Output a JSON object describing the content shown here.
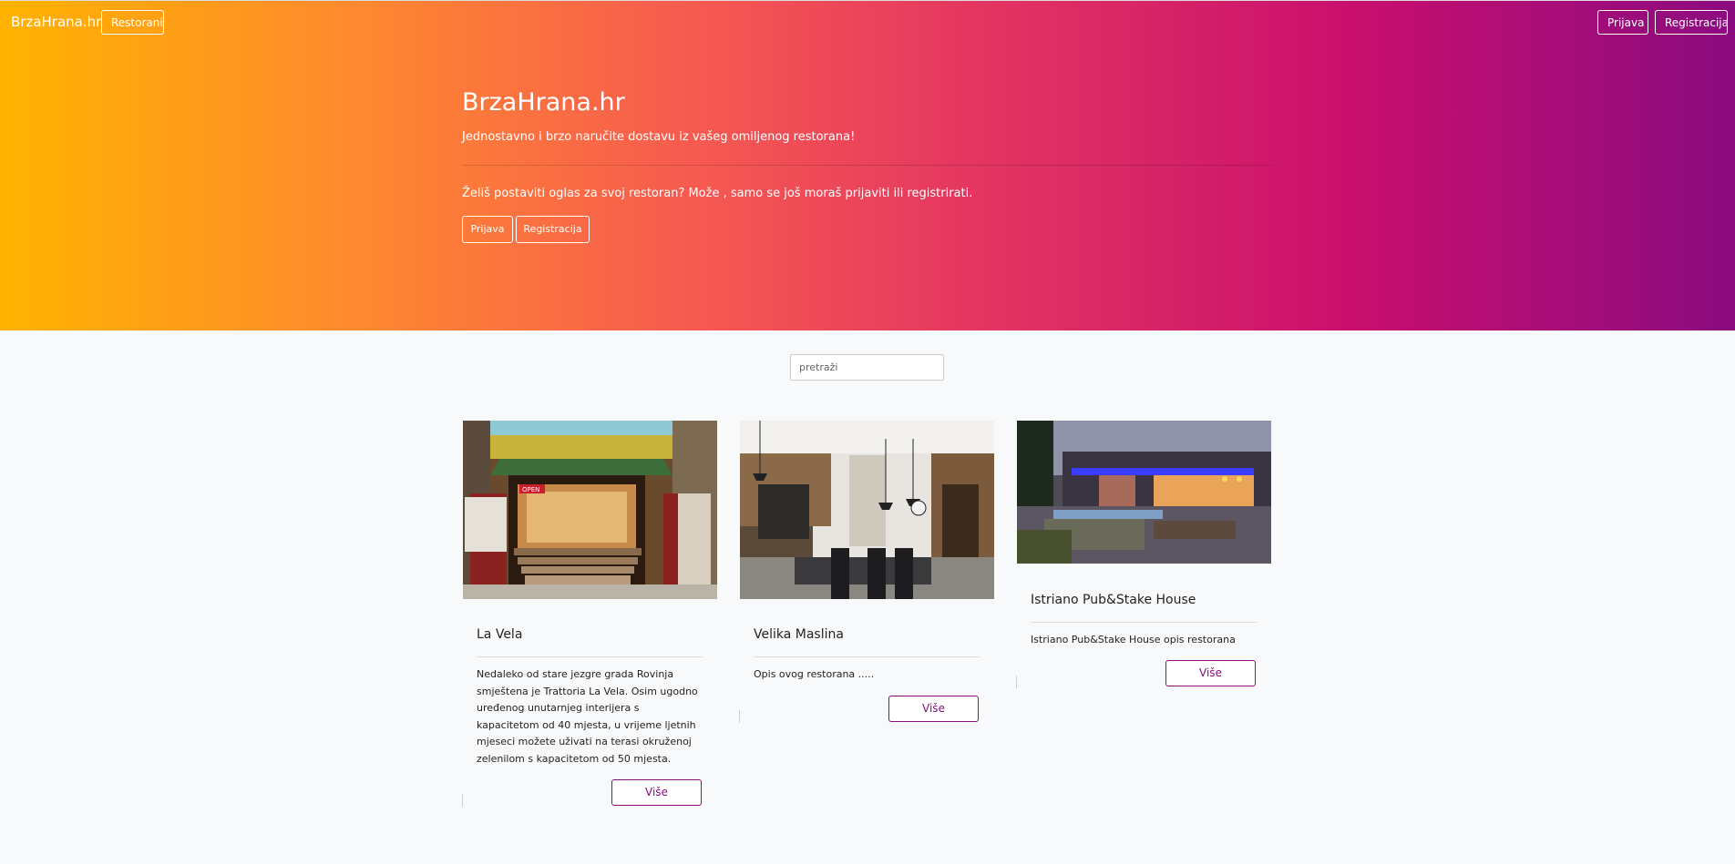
{
  "nav": {
    "brand": "BrzaHrana.hr",
    "restorani": "Restorani",
    "prijava": "Prijava",
    "registracija": "Registracija"
  },
  "hero": {
    "title": "BrzaHrana.hr",
    "subtitle": "Jednostavno i brzo naručite dostavu iz vašeg omiljenog restorana!",
    "cta_text": "Želiš postaviti oglas za svoj restoran? Može , samo se još moraš prijaviti ili registrirati.",
    "prijava": "Prijava",
    "registracija": "Registracija"
  },
  "search": {
    "placeholder": "pretraži"
  },
  "restaurants": [
    {
      "name": "La Vela",
      "description": "Nedaleko od stare jezgre grada Rovinja smještena je Trattoria La Vela. Osim ugodno uređenog unutarnjeg interijera s kapacitetom od 40 mjesta, u vrijeme ljetnih mjeseci možete uživati na terasi okruženoj zelenilom s kapacitetom od 50 mjesta.",
      "more": "Više",
      "image_icon": "restaurant-photo",
      "image_sign": "OPEN"
    },
    {
      "name": "Velika Maslina",
      "description": "Opis ovog restorana .....",
      "more": "Više",
      "image_icon": "restaurant-photo"
    },
    {
      "name": "Istriano Pub&Stake House",
      "description": "Istriano Pub&Stake House opis restorana",
      "more": "Više",
      "image_icon": "restaurant-photo"
    }
  ],
  "colors": {
    "gradient_start": "#ffb300",
    "gradient_end": "#8b0b80",
    "accent": "#8b0b80"
  }
}
